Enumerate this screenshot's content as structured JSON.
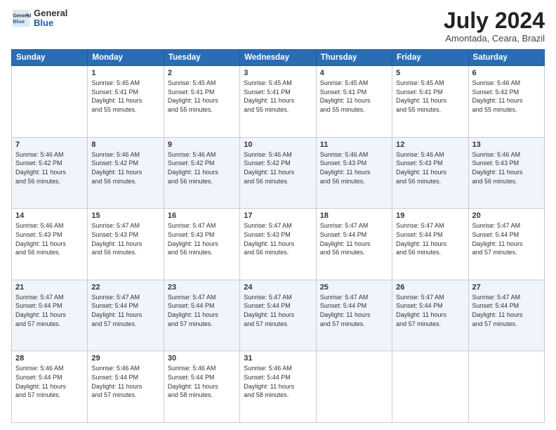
{
  "logo": {
    "general": "General",
    "blue": "Blue"
  },
  "header": {
    "title": "July 2024",
    "subtitle": "Amontada, Ceara, Brazil"
  },
  "weekdays": [
    "Sunday",
    "Monday",
    "Tuesday",
    "Wednesday",
    "Thursday",
    "Friday",
    "Saturday"
  ],
  "weeks": [
    [
      {
        "day": "",
        "info": ""
      },
      {
        "day": "1",
        "info": "Sunrise: 5:45 AM\nSunset: 5:41 PM\nDaylight: 11 hours\nand 55 minutes."
      },
      {
        "day": "2",
        "info": "Sunrise: 5:45 AM\nSunset: 5:41 PM\nDaylight: 11 hours\nand 55 minutes."
      },
      {
        "day": "3",
        "info": "Sunrise: 5:45 AM\nSunset: 5:41 PM\nDaylight: 11 hours\nand 55 minutes."
      },
      {
        "day": "4",
        "info": "Sunrise: 5:45 AM\nSunset: 5:41 PM\nDaylight: 11 hours\nand 55 minutes."
      },
      {
        "day": "5",
        "info": "Sunrise: 5:45 AM\nSunset: 5:41 PM\nDaylight: 11 hours\nand 55 minutes."
      },
      {
        "day": "6",
        "info": "Sunrise: 5:46 AM\nSunset: 5:42 PM\nDaylight: 11 hours\nand 55 minutes."
      }
    ],
    [
      {
        "day": "7",
        "info": "Sunrise: 5:46 AM\nSunset: 5:42 PM\nDaylight: 11 hours\nand 56 minutes."
      },
      {
        "day": "8",
        "info": "Sunrise: 5:46 AM\nSunset: 5:42 PM\nDaylight: 11 hours\nand 56 minutes."
      },
      {
        "day": "9",
        "info": "Sunrise: 5:46 AM\nSunset: 5:42 PM\nDaylight: 11 hours\nand 56 minutes."
      },
      {
        "day": "10",
        "info": "Sunrise: 5:46 AM\nSunset: 5:42 PM\nDaylight: 11 hours\nand 56 minutes."
      },
      {
        "day": "11",
        "info": "Sunrise: 5:46 AM\nSunset: 5:43 PM\nDaylight: 11 hours\nand 56 minutes."
      },
      {
        "day": "12",
        "info": "Sunrise: 5:46 AM\nSunset: 5:43 PM\nDaylight: 11 hours\nand 56 minutes."
      },
      {
        "day": "13",
        "info": "Sunrise: 5:46 AM\nSunset: 5:43 PM\nDaylight: 11 hours\nand 56 minutes."
      }
    ],
    [
      {
        "day": "14",
        "info": "Sunrise: 5:46 AM\nSunset: 5:43 PM\nDaylight: 11 hours\nand 56 minutes."
      },
      {
        "day": "15",
        "info": "Sunrise: 5:47 AM\nSunset: 5:43 PM\nDaylight: 11 hours\nand 56 minutes."
      },
      {
        "day": "16",
        "info": "Sunrise: 5:47 AM\nSunset: 5:43 PM\nDaylight: 11 hours\nand 56 minutes."
      },
      {
        "day": "17",
        "info": "Sunrise: 5:47 AM\nSunset: 5:43 PM\nDaylight: 11 hours\nand 56 minutes."
      },
      {
        "day": "18",
        "info": "Sunrise: 5:47 AM\nSunset: 5:44 PM\nDaylight: 11 hours\nand 56 minutes."
      },
      {
        "day": "19",
        "info": "Sunrise: 5:47 AM\nSunset: 5:44 PM\nDaylight: 11 hours\nand 56 minutes."
      },
      {
        "day": "20",
        "info": "Sunrise: 5:47 AM\nSunset: 5:44 PM\nDaylight: 11 hours\nand 57 minutes."
      }
    ],
    [
      {
        "day": "21",
        "info": "Sunrise: 5:47 AM\nSunset: 5:44 PM\nDaylight: 11 hours\nand 57 minutes."
      },
      {
        "day": "22",
        "info": "Sunrise: 5:47 AM\nSunset: 5:44 PM\nDaylight: 11 hours\nand 57 minutes."
      },
      {
        "day": "23",
        "info": "Sunrise: 5:47 AM\nSunset: 5:44 PM\nDaylight: 11 hours\nand 57 minutes."
      },
      {
        "day": "24",
        "info": "Sunrise: 5:47 AM\nSunset: 5:44 PM\nDaylight: 11 hours\nand 57 minutes."
      },
      {
        "day": "25",
        "info": "Sunrise: 5:47 AM\nSunset: 5:44 PM\nDaylight: 11 hours\nand 57 minutes."
      },
      {
        "day": "26",
        "info": "Sunrise: 5:47 AM\nSunset: 5:44 PM\nDaylight: 11 hours\nand 57 minutes."
      },
      {
        "day": "27",
        "info": "Sunrise: 5:47 AM\nSunset: 5:44 PM\nDaylight: 11 hours\nand 57 minutes."
      }
    ],
    [
      {
        "day": "28",
        "info": "Sunrise: 5:46 AM\nSunset: 5:44 PM\nDaylight: 11 hours\nand 57 minutes."
      },
      {
        "day": "29",
        "info": "Sunrise: 5:46 AM\nSunset: 5:44 PM\nDaylight: 11 hours\nand 57 minutes."
      },
      {
        "day": "30",
        "info": "Sunrise: 5:46 AM\nSunset: 5:44 PM\nDaylight: 11 hours\nand 58 minutes."
      },
      {
        "day": "31",
        "info": "Sunrise: 5:46 AM\nSunset: 5:44 PM\nDaylight: 11 hours\nand 58 minutes."
      },
      {
        "day": "",
        "info": ""
      },
      {
        "day": "",
        "info": ""
      },
      {
        "day": "",
        "info": ""
      }
    ]
  ]
}
